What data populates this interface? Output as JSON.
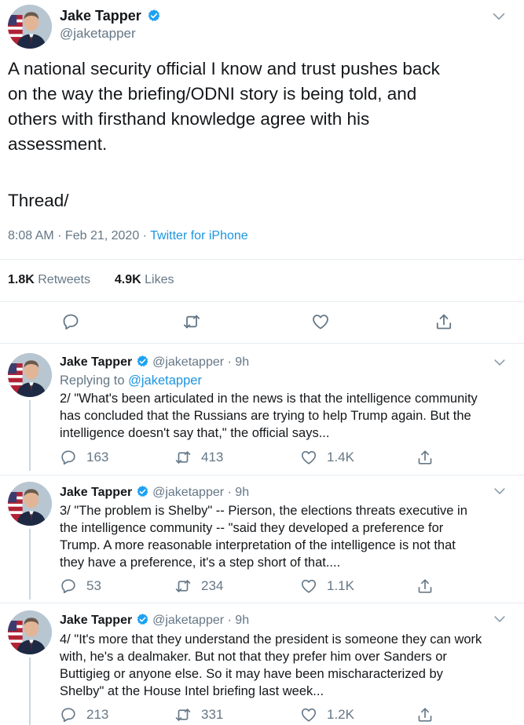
{
  "colors": {
    "accent": "#1b95e0",
    "muted": "#657786",
    "text": "#14171a",
    "divider": "#e6ecf0"
  },
  "main_tweet": {
    "author_name": "Jake Tapper",
    "handle": "@jaketapper",
    "text_lines": [
      "A national security official I know and trust pushes back",
      "on the way the briefing/ODNI story is being told, and",
      "others with firsthand knowledge agree with his",
      "assessment."
    ],
    "text_thread": "Thread/",
    "time_date": "8:08 AM · Feb 21, 2020 · ",
    "source": "Twitter for iPhone",
    "retweets_count": "1.8K",
    "retweets_label": "Retweets",
    "likes_count": "4.9K",
    "likes_label": "Likes"
  },
  "replies": [
    {
      "author_name": "Jake Tapper",
      "handle_time": "@jaketapper · 9h",
      "replying_prefix": "Replying to ",
      "replying_to": "@jaketapper",
      "text_lines": [
        "2/ \"What's been articulated in the news is that the intelligence community",
        "has concluded that the Russians are trying to help Trump again. But the",
        "intelligence doesn't say that,\" the official says..."
      ],
      "replies_count": "163",
      "retweets_count": "413",
      "likes_count": "1.4K"
    },
    {
      "author_name": "Jake Tapper",
      "handle_time": "@jaketapper · 9h",
      "text_lines": [
        "3/ \"The problem is Shelby\" -- Pierson, the elections threats executive in",
        "the intelligence community -- \"said they developed a preference for",
        "Trump. A more reasonable interpretation of the intelligence is not that",
        "they have a preference, it's a step short of that...."
      ],
      "replies_count": "53",
      "retweets_count": "234",
      "likes_count": "1.1K"
    },
    {
      "author_name": "Jake Tapper",
      "handle_time": "@jaketapper · 9h",
      "text_lines": [
        "4/ \"It's more that they understand the president is someone they can work",
        "with, he's a dealmaker. But not that they prefer him over Sanders or",
        "Buttigieg or anyone else. So it may have been mischaracterized by",
        "Shelby\" at the House Intel briefing last week..."
      ],
      "replies_count": "213",
      "retweets_count": "331",
      "likes_count": "1.2K"
    }
  ],
  "icons": {
    "verified": "verified-badge-icon",
    "more": "chevron-down-icon",
    "reply": "reply-icon",
    "retweet": "retweet-icon",
    "like": "heart-icon",
    "share": "share-icon"
  }
}
